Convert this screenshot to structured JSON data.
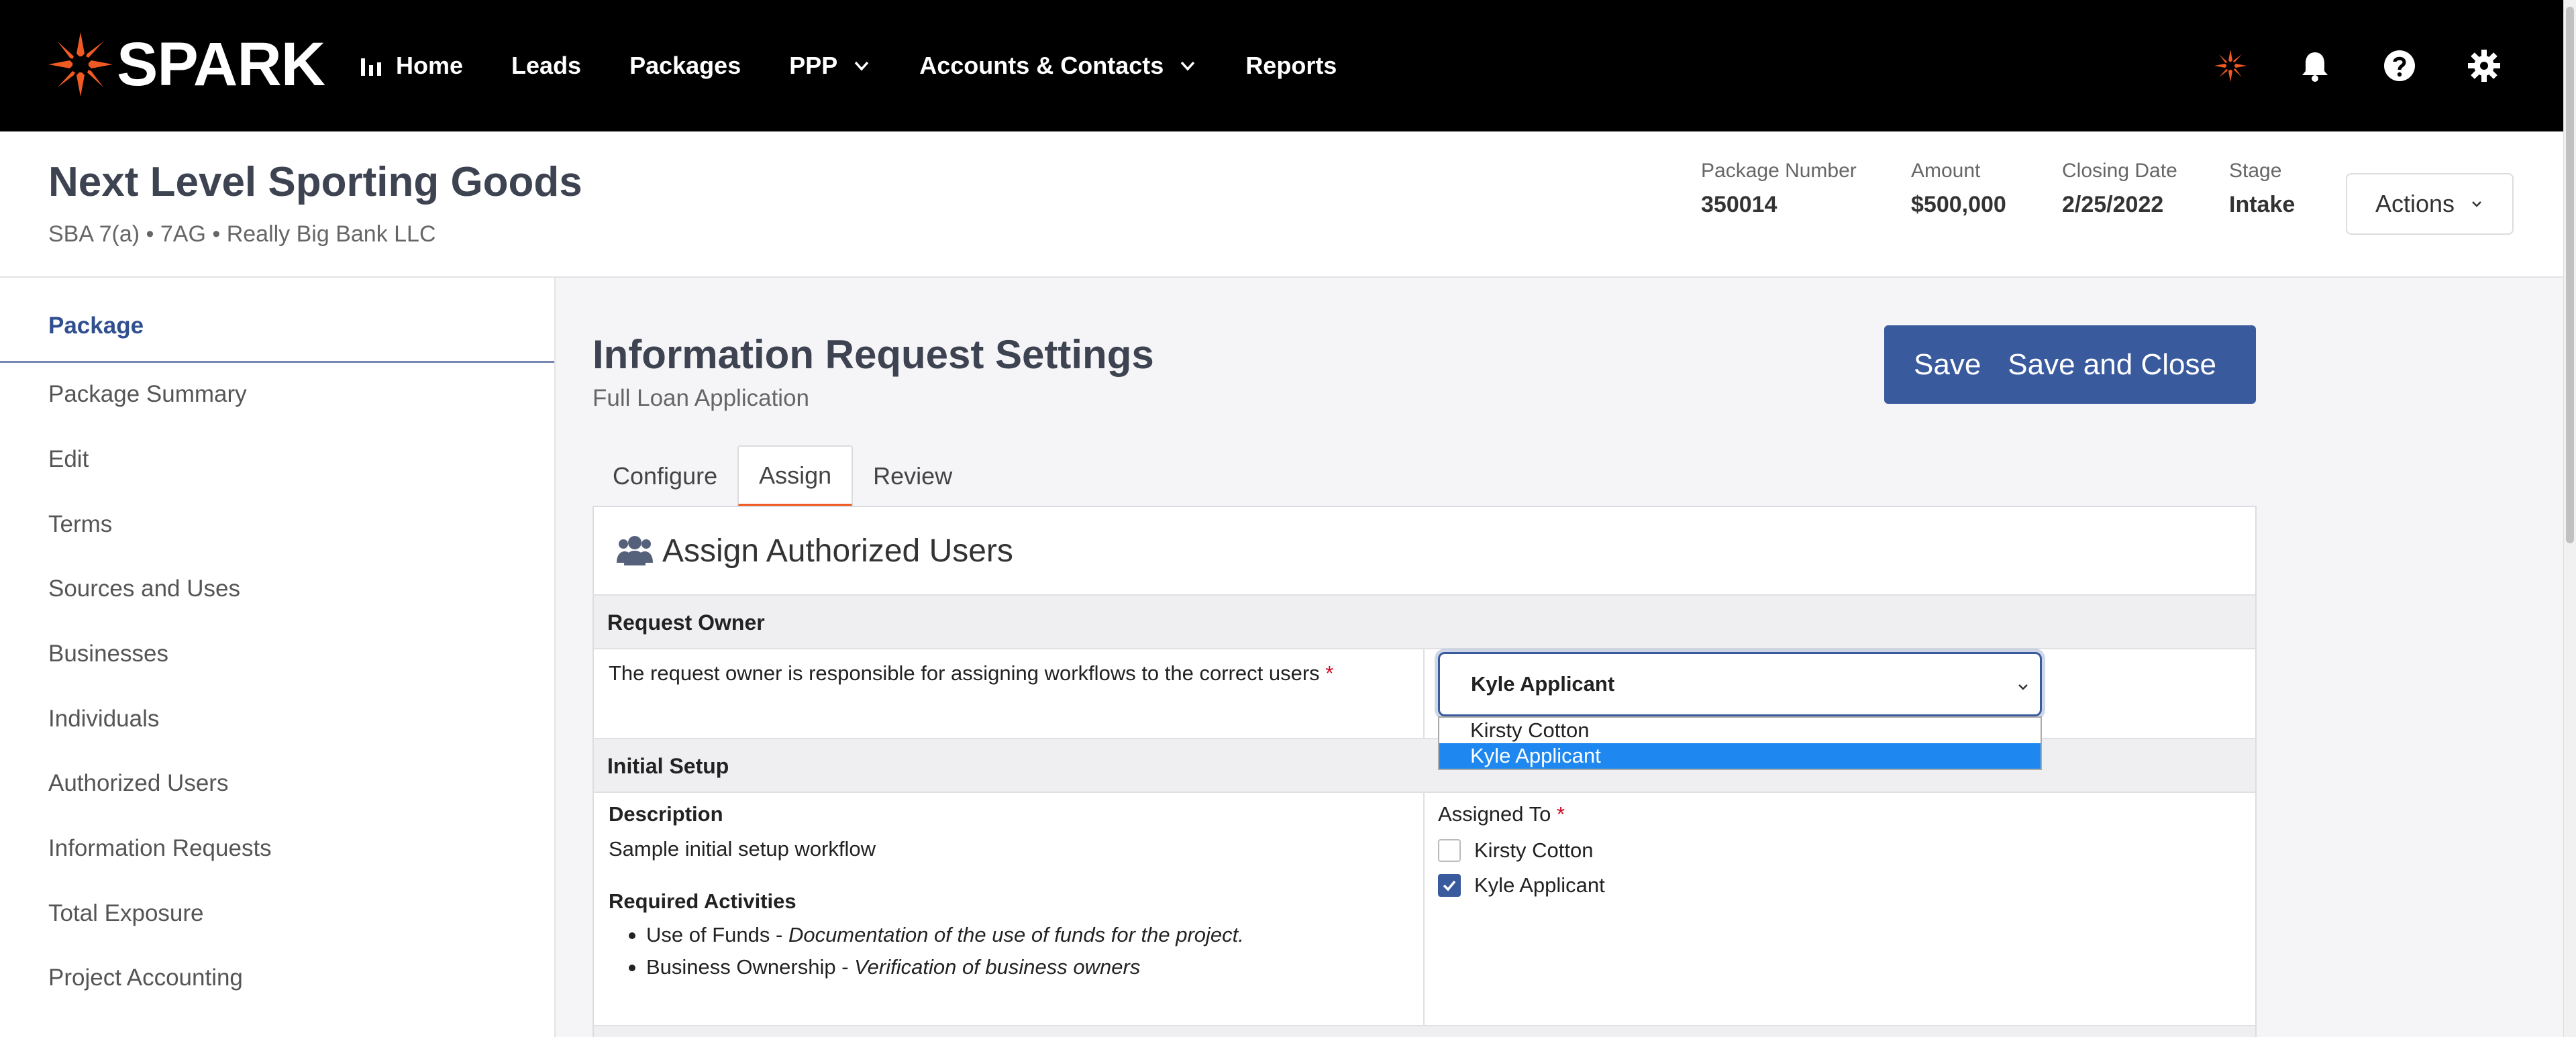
{
  "nav": {
    "brand": "SPARK",
    "items": [
      {
        "label": "Home",
        "icon": "bar-chart-icon"
      },
      {
        "label": "Leads"
      },
      {
        "label": "Packages"
      },
      {
        "label": "PPP",
        "icon": "chevron-down-icon"
      },
      {
        "label": "Accounts & Contacts",
        "icon": "chevron-down-icon"
      },
      {
        "label": "Reports"
      }
    ],
    "right_icons": [
      "spark-burst-icon",
      "bell-icon",
      "help-icon",
      "gear-icon"
    ],
    "accent_color": "#f15a22"
  },
  "header": {
    "company": "Next Level Sporting Goods",
    "subline": "SBA 7(a) • 7AG • Really Big Bank LLC",
    "stats": [
      {
        "label": "Package Number",
        "value": "350014"
      },
      {
        "label": "Amount",
        "value": "$500,000"
      },
      {
        "label": "Closing Date",
        "value": "2/25/2022"
      },
      {
        "label": "Stage",
        "value": "Intake"
      }
    ],
    "actions_label": "Actions"
  },
  "sidebar": {
    "heading": "Package",
    "items": [
      "Package Summary",
      "Edit",
      "Terms",
      "Sources and Uses",
      "Businesses",
      "Individuals",
      "Authorized Users",
      "Information Requests",
      "Total Exposure",
      "Project Accounting"
    ]
  },
  "main": {
    "title": "Information Request Settings",
    "subtitle": "Full Loan Application",
    "save_label": "Save",
    "save_close_label": "Save and Close",
    "tabs": [
      {
        "label": "Configure",
        "active": false
      },
      {
        "label": "Assign",
        "active": true
      },
      {
        "label": "Review",
        "active": false
      }
    ],
    "primary_color": "#3a5a9e"
  },
  "panel": {
    "title": "Assign Authorized Users",
    "request_owner": {
      "section": "Request Owner",
      "description": "The request owner is responsible for assigning workflows to the correct users",
      "required_mark": "*",
      "selected": "Kyle Applicant",
      "options": [
        "Kirsty Cotton",
        "Kyle Applicant"
      ],
      "highlighted_option": "Kyle Applicant"
    },
    "initial_setup": {
      "section": "Initial Setup",
      "description_label": "Description",
      "description": "Sample initial setup workflow",
      "activities_label": "Required Activities",
      "activities": [
        {
          "name": "Use of Funds",
          "sep": " - ",
          "detail": "Documentation of the use of funds for the project."
        },
        {
          "name": "Business Ownership",
          "sep": " - ",
          "detail": "Verification of business owners"
        }
      ],
      "assigned_label": "Assigned To",
      "required_mark": "*",
      "assignees": [
        {
          "name": "Kirsty Cotton",
          "checked": false
        },
        {
          "name": "Kyle Applicant",
          "checked": true
        }
      ]
    }
  }
}
